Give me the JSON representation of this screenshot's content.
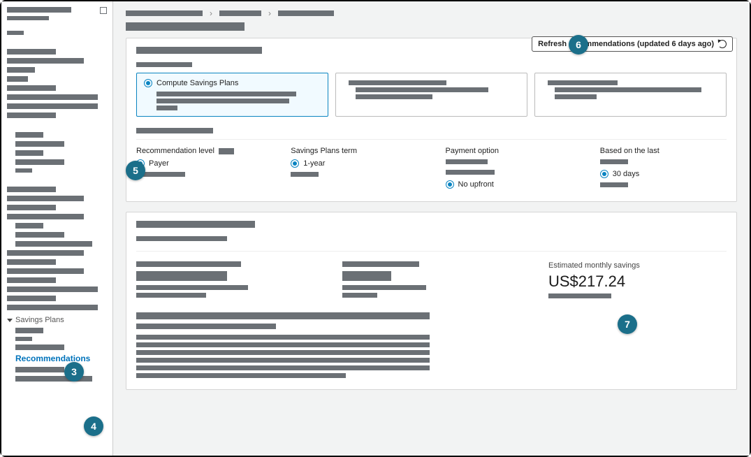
{
  "sidebar": {
    "expanded_section_label": "Savings Plans",
    "active_item": "Recommendations"
  },
  "header": {
    "refresh_button_label": "Refresh recommendations (updated 6 days ago)"
  },
  "plan_cards": {
    "selected_label": "Compute Savings Plans"
  },
  "parameters": {
    "recommendation_level": {
      "title": "Recommendation level",
      "selected": "Payer"
    },
    "term": {
      "title": "Savings Plans term",
      "selected": "1-year"
    },
    "payment": {
      "title": "Payment option",
      "selected": "No upfront"
    },
    "based_on": {
      "title": "Based on the last",
      "selected": "30 days"
    }
  },
  "summary": {
    "estimated_savings_label": "Estimated monthly savings",
    "estimated_savings_value": "US$217.24"
  },
  "callouts": {
    "c3": "3",
    "c4": "4",
    "c5": "5",
    "c6": "6",
    "c7": "7"
  }
}
